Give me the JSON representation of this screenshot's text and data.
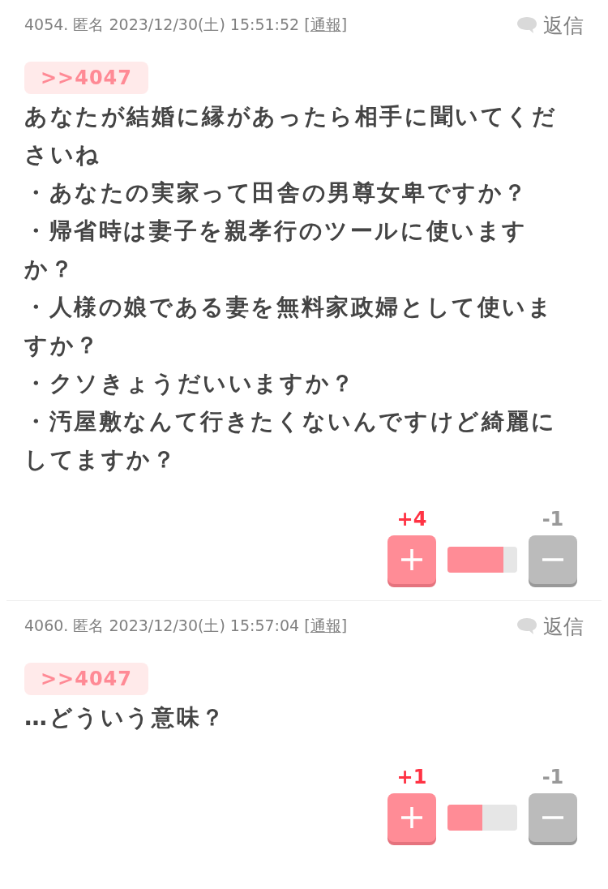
{
  "posts": [
    {
      "number": "4054.",
      "author": "匿名",
      "datetime": "2023/12/30(土) 15:51:52",
      "bracket_open": "[",
      "report": "通報",
      "bracket_close": "]",
      "reply": "返信",
      "quote": ">>4047",
      "lines": [
        "あなたが結婚に縁があったら相手に聞いてくださいね",
        "・あなたの実家って田舎の男尊女卑ですか？",
        "・帰省時は妻子を親孝行のツールに使いますか？",
        "・人様の娘である妻を無料家政婦として使いますか？",
        "・クソきょうだいいますか？",
        "・汚屋敷なんて行きたくないんですけど綺麗にしてますか？"
      ],
      "plus_count": "+4",
      "minus_count": "-1",
      "level": 0.8
    },
    {
      "number": "4060.",
      "author": "匿名",
      "datetime": "2023/12/30(土) 15:57:04",
      "bracket_open": "[",
      "report": "通報",
      "bracket_close": "]",
      "reply": "返信",
      "quote": ">>4047",
      "lines": [
        "…どういう意味？"
      ],
      "plus_count": "+1",
      "minus_count": "-1",
      "level": 0.5
    }
  ]
}
